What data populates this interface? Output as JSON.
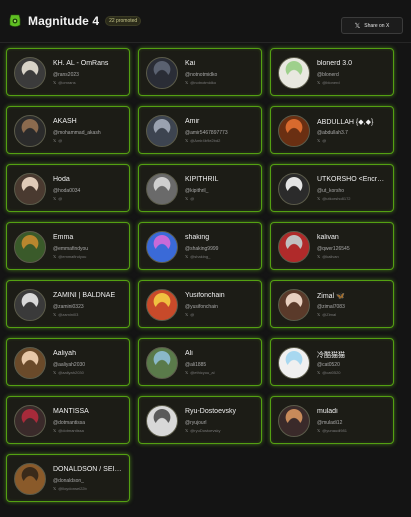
{
  "header": {
    "title": "Magnitude 4",
    "badge": "22 promoted",
    "share_label": "Share on X",
    "share_icon": "x-logo-icon",
    "logo_icon": "green-lantern-icon",
    "accent": "#6ccf1e"
  },
  "cards": [
    {
      "name": "KH. AL - OmRans",
      "handle": "@rans2023",
      "x": "@omrans",
      "avatar": [
        "#d8d3c8",
        "#3b3b3b"
      ]
    },
    {
      "name": "Kai",
      "handle": "@notnotmidko",
      "x": "@notnotmidko",
      "avatar": [
        "#5a6170",
        "#2a2d36"
      ]
    },
    {
      "name": "blonerd 3.0",
      "handle": "@blonerd",
      "x": "@blonerd",
      "avatar": [
        "#9ed08c",
        "#e8e8e0"
      ]
    },
    {
      "name": "AKASH",
      "handle": "@mohammad_akash",
      "x": "@",
      "avatar": [
        "#8b6a4e",
        "#2b2b2b"
      ]
    },
    {
      "name": "Amir",
      "handle": "@amir5467897773",
      "x": "@Amir4b9e2bd2",
      "avatar": [
        "#9aa2b0",
        "#3d4450"
      ]
    },
    {
      "name": "ABDULLAH {◆,◆}",
      "handle": "@abdullah3.7",
      "x": "@",
      "avatar": [
        "#d86a2e",
        "#6a2f12"
      ]
    },
    {
      "name": "Hoda",
      "handle": "@hoda0034",
      "x": "@",
      "avatar": [
        "#e0cbb8",
        "#4a3a30"
      ]
    },
    {
      "name": "KIPITHRIL",
      "handle": "@kipithril_",
      "x": "@",
      "avatar": [
        "#cfcfcf",
        "#6a6a6a"
      ]
    },
    {
      "name": "UTKORSHO <Encr…",
      "handle": "@ut_korsho",
      "x": "@utkorsho8172",
      "avatar": [
        "#e4e4e4",
        "#2b2b2b"
      ]
    },
    {
      "name": "Emma",
      "handle": "@emmafindyou",
      "x": "@emmafindyou",
      "avatar": [
        "#b8862e",
        "#3a5a2a"
      ]
    },
    {
      "name": "shaking",
      "handle": "@shaking9999",
      "x": "@shaking_",
      "avatar": [
        "#c86ad8",
        "#3a6ad8"
      ]
    },
    {
      "name": "kalivan",
      "handle": "@qwer126545",
      "x": "@kalivan",
      "avatar": [
        "#c0c0c0",
        "#b02a2a"
      ]
    },
    {
      "name": "ZAMINI | BALDNAE",
      "handle": "@zamini0323",
      "x": "@zamini03",
      "avatar": [
        "#d8d8d8",
        "#3a3a3a"
      ]
    },
    {
      "name": "Yusifonchain",
      "handle": "@yusifonchain",
      "x": "@",
      "avatar": [
        "#f0c040",
        "#c84a2a"
      ]
    },
    {
      "name": "Zimal 🦋",
      "handle": "@zimal7083",
      "x": "@Zimal",
      "avatar": [
        "#e8d0c0",
        "#5a3a2a"
      ]
    },
    {
      "name": "Aaliyah",
      "handle": "@aaliyah2030",
      "x": "@aaliyah2030",
      "avatar": [
        "#e8c8a8",
        "#6a4a2a"
      ]
    },
    {
      "name": "Ali",
      "handle": "@ali1885",
      "x": "@ethicyou_al",
      "avatar": [
        "#8ab8c8",
        "#5a7a4a"
      ]
    },
    {
      "name": "冷酷猫猫",
      "handle": "@cat0520",
      "x": "@cat0520",
      "avatar": [
        "#a8d8f0",
        "#f0f0f0"
      ]
    },
    {
      "name": "MANTISSA",
      "handle": "@dotmantissa",
      "x": "@dotmantissa",
      "avatar": [
        "#a82a3a",
        "#3a2a2a"
      ]
    },
    {
      "name": "Ryu-Dostoevsky",
      "handle": "@ryujourl",
      "x": "@ryuDostoevsky",
      "avatar": [
        "#5a5a5a",
        "#d8d8d8"
      ]
    },
    {
      "name": "muladi",
      "handle": "@muladi12",
      "x": "@yunaudi981",
      "avatar": [
        "#c88a5a",
        "#3a2a2a"
      ]
    },
    {
      "name": "DONALDSON / SEI…",
      "handle": "@donaldson_",
      "x": "@lloydonsei22b",
      "avatar": [
        "#3a2a1a",
        "#8a5a2a"
      ]
    }
  ]
}
